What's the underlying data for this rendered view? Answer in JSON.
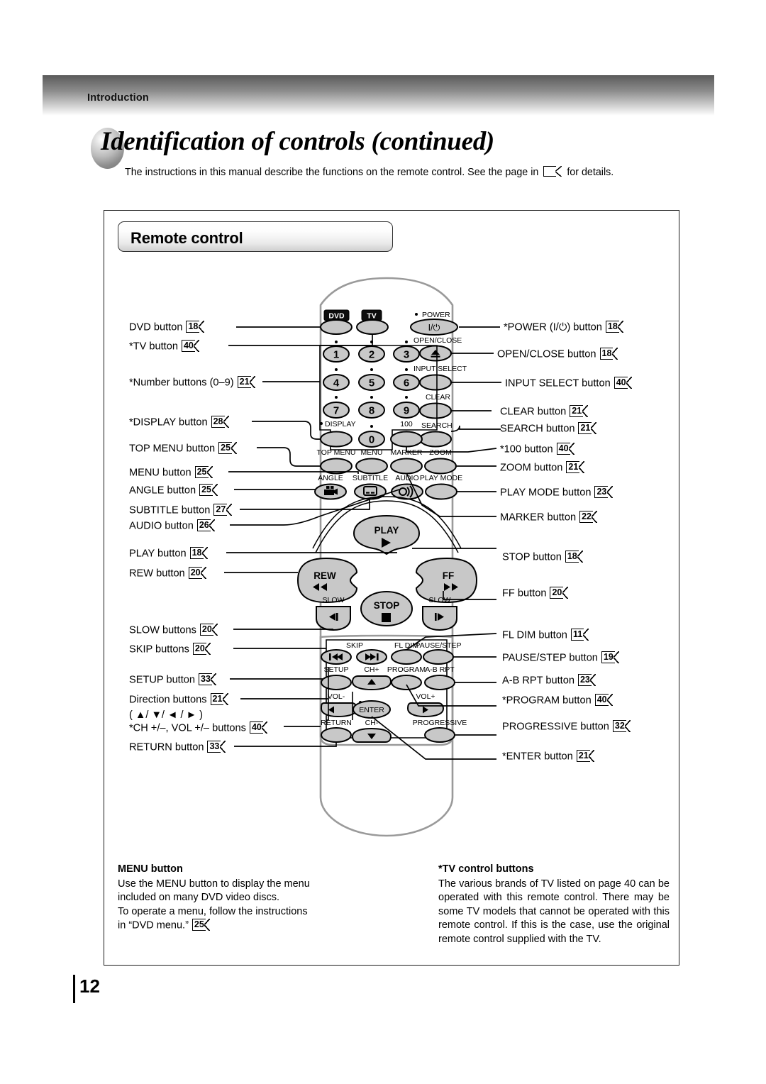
{
  "header": {
    "chapter": "Introduction"
  },
  "title": {
    "text": "Identification of controls (continued)"
  },
  "intro": {
    "before": "The instructions in this manual describe the functions on the remote control. See the page in",
    "after": "for details."
  },
  "section": {
    "heading": "Remote control"
  },
  "labels_left": [
    {
      "text": "DVD button",
      "page": "18"
    },
    {
      "text": "*TV button",
      "page": "40"
    },
    {
      "text": "*Number buttons (0–9)",
      "page": "21"
    },
    {
      "text": "*DISPLAY button",
      "page": "28"
    },
    {
      "text": "TOP MENU button",
      "page": "25"
    },
    {
      "text": "MENU button",
      "page": "25"
    },
    {
      "text": "ANGLE button",
      "page": "25"
    },
    {
      "text": "SUBTITLE button",
      "page": "27"
    },
    {
      "text": "AUDIO button",
      "page": "26"
    },
    {
      "text": "PLAY button",
      "page": "18"
    },
    {
      "text": "REW button",
      "page": "20"
    },
    {
      "text": "SLOW buttons",
      "page": "20"
    },
    {
      "text": "SKIP buttons",
      "page": "20"
    },
    {
      "text": "SETUP button",
      "page": "33"
    },
    {
      "text": "Direction buttons",
      "page": "21"
    },
    {
      "text": "( ▲/ ▼/ ◄ / ► )",
      "page": ""
    },
    {
      "text": "*CH +/–, VOL +/– buttons",
      "page": "40"
    },
    {
      "text": "RETURN button",
      "page": "33"
    }
  ],
  "labels_right": [
    {
      "text": "*POWER (I/⏻) button",
      "page": "18"
    },
    {
      "text": "OPEN/CLOSE button",
      "page": "18"
    },
    {
      "text": "INPUT SELECT button",
      "page": "40"
    },
    {
      "text": "CLEAR button",
      "page": "21"
    },
    {
      "text": "SEARCH button",
      "page": "21"
    },
    {
      "text": "*100 button",
      "page": "40"
    },
    {
      "text": "ZOOM button",
      "page": "21"
    },
    {
      "text": "PLAY MODE button",
      "page": "23"
    },
    {
      "text": "MARKER button",
      "page": "22"
    },
    {
      "text": "STOP button",
      "page": "18"
    },
    {
      "text": "FF button",
      "page": "20"
    },
    {
      "text": "FL DIM button",
      "page": "11"
    },
    {
      "text": "PAUSE/STEP button",
      "page": "19"
    },
    {
      "text": "A-B RPT button",
      "page": "23"
    },
    {
      "text": "*PROGRAM button",
      "page": "40"
    },
    {
      "text": "PROGRESSIVE button",
      "page": "32"
    },
    {
      "text": "*ENTER button",
      "page": "21"
    }
  ],
  "remote": {
    "mode_buttons": [
      "DVD",
      "TV"
    ],
    "power_label": "POWER",
    "power_glyph": "I/⏻",
    "open_close_label": "OPEN/CLOSE",
    "input_select_label": "INPUT SELECT",
    "clear_label": "CLEAR",
    "search_label": "SEARCH",
    "numbers": [
      "1",
      "2",
      "3",
      "4",
      "5",
      "6",
      "7",
      "8",
      "9",
      "0"
    ],
    "hundred_label": "100",
    "display_label": "DISPLAY",
    "top_menu_label": "TOP MENU",
    "menu_label": "MENU",
    "marker_label": "MARKER",
    "zoom_label": "ZOOM",
    "angle_label": "ANGLE",
    "subtitle_label": "SUBTITLE",
    "audio_label": "AUDIO",
    "play_mode_label": "PLAY MODE",
    "play_label": "PLAY",
    "rew_label": "REW",
    "ff_label": "FF",
    "stop_label": "STOP",
    "slow_left_label": "SLOW",
    "slow_right_label": "SLOW",
    "skip_label": "SKIP",
    "fl_dim_label": "FL DIM",
    "pause_step_label": "PAUSE/STEP",
    "setup_label": "SETUP",
    "ch_plus_label": "CH+",
    "program_label": "PROGRAM",
    "ab_rpt_label": "A-B RPT",
    "vol_minus_label": "VOL-",
    "vol_plus_label": "VOL+",
    "enter_label": "ENTER",
    "return_label": "RETURN",
    "ch_minus_label": "CH-",
    "progressive_label": "PROGRESSIVE"
  },
  "notes": {
    "left_title": "MENU button",
    "left_body_1": "Use the MENU button to display the menu",
    "left_body_2": "included on many DVD video discs.",
    "left_body_3": "To operate a menu, follow the instructions",
    "left_body_4": "in “DVD menu.”",
    "left_page": "25",
    "right_title": "*TV control buttons",
    "right_body": "The various brands of TV listed on page 40 can be operated with this remote control. There may be some TV models that cannot be operated with this remote control. If this is the case, use the original remote control supplied with the TV."
  },
  "page_number": "12",
  "colors": {
    "button_fill": "#c8c8c8",
    "body_outline": "#9a9a9a",
    "ink": "#000000"
  }
}
